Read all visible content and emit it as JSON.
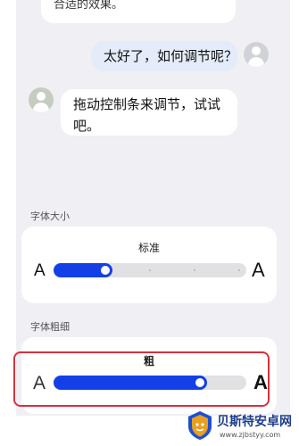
{
  "chat": {
    "top_fragment": "合适的效果。",
    "user_message": "太好了，如何调节呢？",
    "bot_message": "拖动控制条来调节，试试吧。"
  },
  "font_size": {
    "section_label": "字体大小",
    "level_label": "标准",
    "small_glyph": "A",
    "large_glyph": "A",
    "level": 2,
    "levels": 5
  },
  "font_weight": {
    "section_label": "字体粗细",
    "level_label": "粗",
    "small_glyph": "A",
    "large_glyph": "A",
    "value": 0.78
  },
  "colors": {
    "accent": "#1340e6",
    "highlight": "#d8303c"
  },
  "watermark": {
    "title": "贝斯特安卓网",
    "url": "www.zjbstyy.com"
  }
}
